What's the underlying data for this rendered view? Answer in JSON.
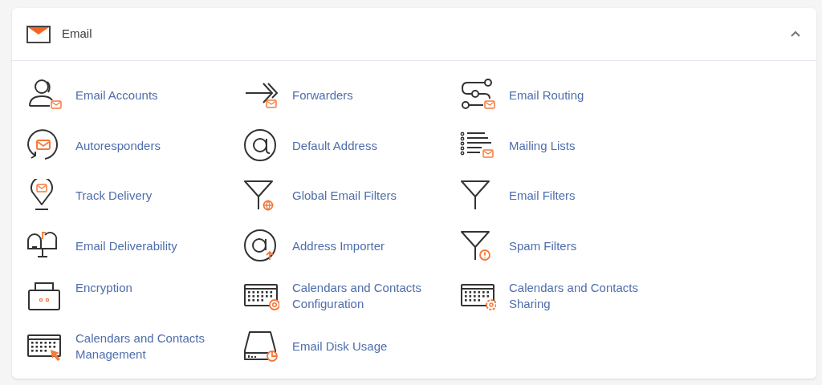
{
  "section": {
    "title": "Email",
    "expanded": true,
    "items": [
      {
        "label": "Email Accounts",
        "kind": "accounts"
      },
      {
        "label": "Forwarders",
        "kind": "forwarders"
      },
      {
        "label": "Email Routing",
        "kind": "routing"
      },
      {
        "label": "Autoresponders",
        "kind": "autoresponders"
      },
      {
        "label": "Default Address",
        "kind": "at"
      },
      {
        "label": "Mailing Lists",
        "kind": "list"
      },
      {
        "label": "Track Delivery",
        "kind": "pin"
      },
      {
        "label": "Global Email Filters",
        "kind": "filter_globe"
      },
      {
        "label": "Email Filters",
        "kind": "filter"
      },
      {
        "label": "Email Deliverability",
        "kind": "mailbox"
      },
      {
        "label": "Address Importer",
        "kind": "at_up"
      },
      {
        "label": "Spam Filters",
        "kind": "filter_alert"
      },
      {
        "label": "Encryption",
        "kind": "case"
      },
      {
        "label": "Calendars and Contacts Configuration",
        "kind": "cal_at"
      },
      {
        "label": "Calendars and Contacts Sharing",
        "kind": "cal_gear"
      },
      {
        "label": "Calendars and Contacts Management",
        "kind": "cal_cursor"
      },
      {
        "label": "Email Disk Usage",
        "kind": "disk"
      }
    ]
  }
}
